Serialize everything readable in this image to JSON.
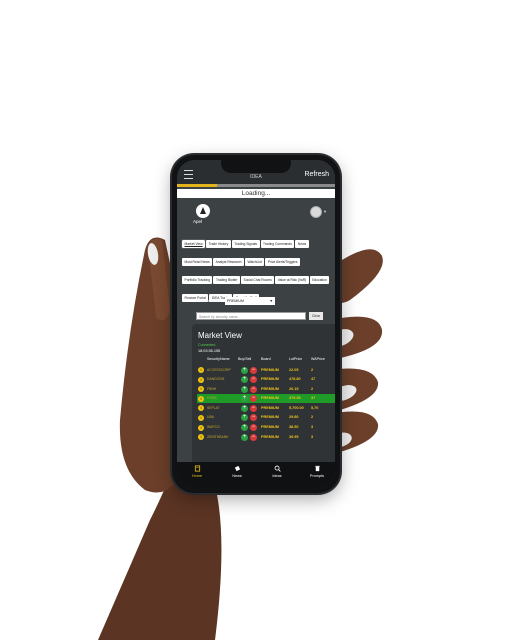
{
  "app": {
    "title": "IDEA",
    "refresh_label": "Refresh",
    "loading_label": "Loading...",
    "progress_fraction": 0.25,
    "logo_text": "Apel"
  },
  "nav_chips": [
    "Market View",
    "Trade History",
    "Trading Signals",
    "Trading Commands",
    "News",
    "Most Read News",
    "Analyst Research",
    "WatchList",
    "Price Alerts/Triggers",
    "Portfolio Tracking",
    "Trading Blotter",
    "Social Chat Rooms",
    "Value at Risk (VaR)",
    "Education",
    "Finance Portal",
    "IDEA Trader",
    "Grow My Stuff"
  ],
  "board_select": {
    "label": "Select a board",
    "value": "PREMIUM"
  },
  "search": {
    "placeholder": "Search by security name...",
    "clear_label": "Clear"
  },
  "market_view": {
    "title": "Market View",
    "status": "Connected",
    "time": "18:03:36.155",
    "columns": [
      "SecurityName",
      "Buy/Sell",
      "Board",
      "LotPrice",
      "WAPrice"
    ],
    "rows": [
      {
        "security": "ACCESSCORP",
        "board": "PREMIUM",
        "price": "22.05",
        "wavg": "2"
      },
      {
        "security": "DANGCEM",
        "board": "PREMIUM",
        "price": "478.80",
        "wavg": "47"
      },
      {
        "security": "FBNH",
        "board": "PREMIUM",
        "price": "26.15",
        "wavg": "2"
      },
      {
        "security": "HTNG",
        "board": "PREMIUM",
        "price": "379.35",
        "wavg": "37"
      },
      {
        "security": "SEPLAT",
        "board": "PREMIUM",
        "price": "5,700.00",
        "wavg": "5,70"
      },
      {
        "security": "UBA",
        "board": "PREMIUM",
        "price": "29.80",
        "wavg": "2"
      },
      {
        "security": "WAPCO",
        "board": "PREMIUM",
        "price": "38.50",
        "wavg": "3"
      },
      {
        "security": "ZENITHBANK",
        "board": "PREMIUM",
        "price": "39.95",
        "wavg": "3"
      }
    ],
    "highlighted_row": 3
  },
  "bottom_nav": [
    {
      "label": "Home",
      "icon": "home-icon"
    },
    {
      "label": "News",
      "icon": "news-icon"
    },
    {
      "label": "Ideas",
      "icon": "ideas-icon"
    },
    {
      "label": "Prompts",
      "icon": "prompts-icon"
    }
  ],
  "colors": {
    "accent": "#f0c419",
    "buy": "#2ea043",
    "sell": "#d83a3a",
    "highlight_row": "#1f9b28"
  }
}
